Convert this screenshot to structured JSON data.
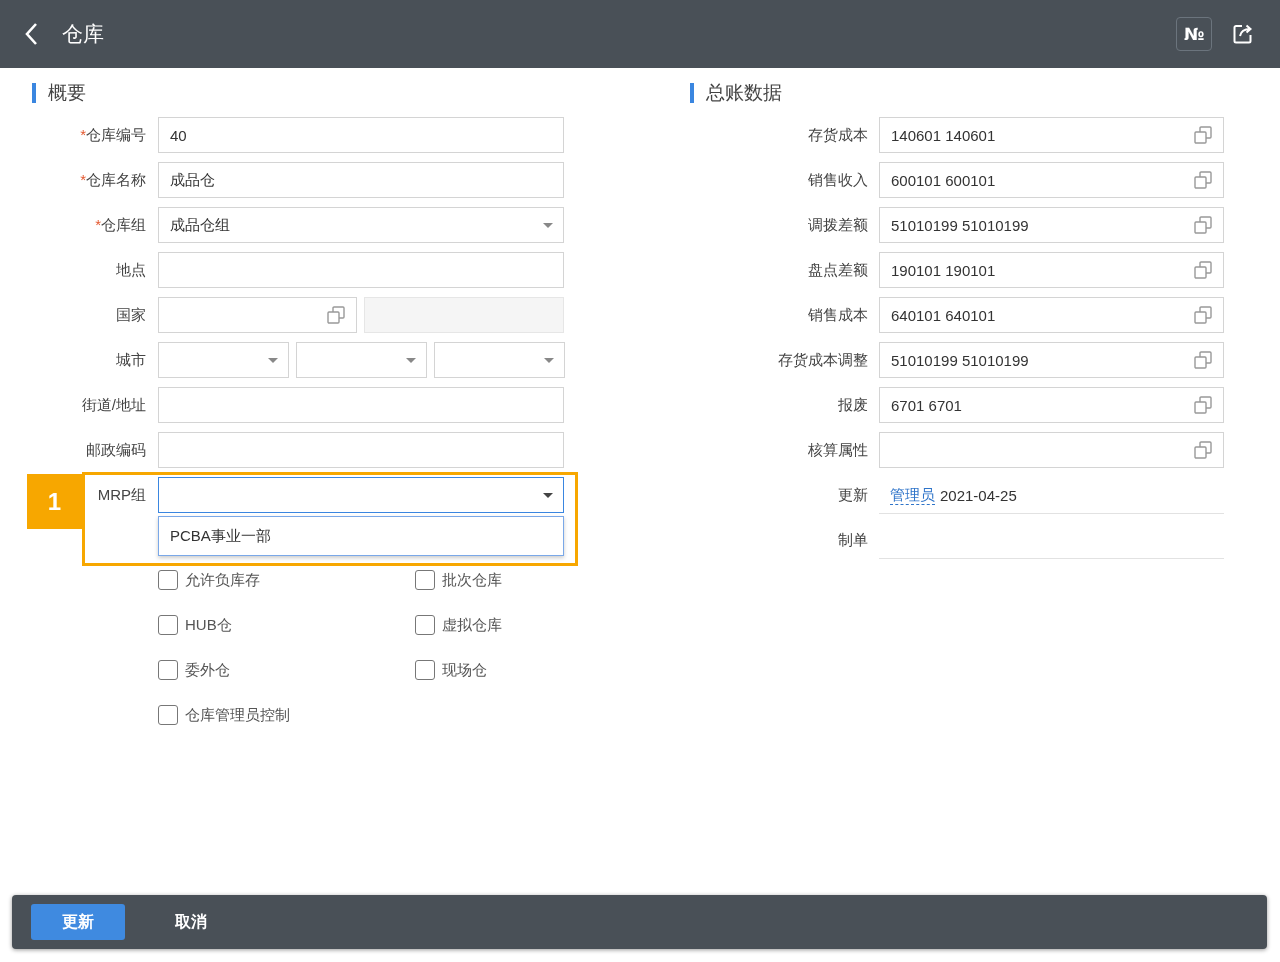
{
  "header": {
    "title": "仓库",
    "number_button": "№"
  },
  "summary": {
    "title": "概要",
    "fields": [
      {
        "label": "仓库编号",
        "required_mark": "*",
        "kind": "text",
        "value": "40"
      },
      {
        "label": "仓库名称",
        "required_mark": "*",
        "kind": "text",
        "value": "成品仓"
      },
      {
        "label": "仓库组",
        "required_mark": "*",
        "kind": "select",
        "value": "成品仓组"
      },
      {
        "label": "地点",
        "kind": "text"
      },
      {
        "label": "国家",
        "kind": "lookup"
      },
      {
        "label": "城市",
        "kind": "triple"
      },
      {
        "label": "街道/地址",
        "kind": "text"
      },
      {
        "label": "邮政编码",
        "kind": "text"
      },
      {
        "label": "MRP组",
        "kind": "dropdown",
        "expanded": true,
        "options": [
          "PCBA事业一部"
        ],
        "callout": "1"
      }
    ],
    "checkboxes": [
      {
        "label": "允许负库存",
        "checked": false
      },
      {
        "label": "批次仓库",
        "checked": false
      },
      {
        "label": "HUB仓",
        "checked": false
      },
      {
        "label": "虚拟仓库",
        "checked": false
      },
      {
        "label": "委外仓",
        "checked": false
      },
      {
        "label": "现场仓",
        "checked": false
      },
      {
        "label": "仓库管理员控制",
        "checked": false
      }
    ]
  },
  "ledger": {
    "title": "总账数据",
    "fields": [
      {
        "label": "存货成本",
        "kind": "lookup",
        "value": "140601 140601"
      },
      {
        "label": "销售收入",
        "kind": "lookup",
        "value": "600101 600101"
      },
      {
        "label": "调拨差额",
        "kind": "lookup",
        "value": "51010199 51010199"
      },
      {
        "label": "盘点差额",
        "kind": "lookup",
        "value": "190101 190101"
      },
      {
        "label": "销售成本",
        "kind": "lookup",
        "value": "640101 640101"
      },
      {
        "label": "存货成本调整",
        "kind": "lookup",
        "value": "51010199 51010199"
      },
      {
        "label": "报废",
        "kind": "lookup",
        "value": "6701 6701"
      },
      {
        "label": "核算属性",
        "kind": "lookup"
      },
      {
        "label": "更新",
        "kind": "info",
        "user": "管理员",
        "value": "2021-04-25"
      },
      {
        "label": "制单",
        "kind": "info"
      }
    ]
  },
  "footer": {
    "buttons": [
      {
        "label": "更新",
        "primary": true
      },
      {
        "label": "取消",
        "primary": false
      }
    ]
  }
}
